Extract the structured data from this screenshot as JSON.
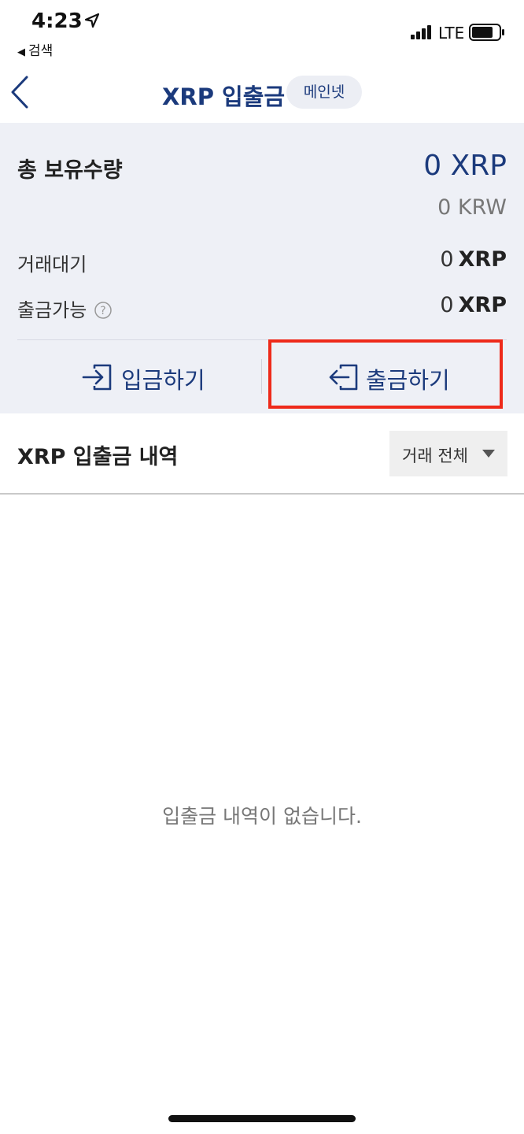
{
  "status_bar": {
    "time": "4:23",
    "back_label": "검색",
    "network": "LTE"
  },
  "nav": {
    "title": "XRP 입출금",
    "network_badge": "메인넷"
  },
  "summary": {
    "total_label": "총 보유수량",
    "total_xrp": "0 XRP",
    "total_krw": "0 KRW",
    "pending_label": "거래대기",
    "pending_value": "0",
    "pending_unit": "XRP",
    "available_label": "출금가능",
    "available_value": "0",
    "available_unit": "XRP"
  },
  "actions": {
    "deposit_label": "입금하기",
    "withdraw_label": "출금하기"
  },
  "history": {
    "title": "XRP 입출금 내역",
    "filter_selected": "거래 전체",
    "empty_message": "입출금 내역이 없습니다."
  },
  "colors": {
    "brand": "#1b3a7c",
    "highlight": "#ee2a1a",
    "panel_bg": "#eef0f6"
  }
}
